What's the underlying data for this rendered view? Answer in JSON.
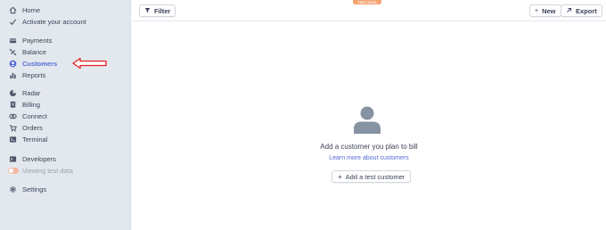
{
  "sidebar": {
    "group1": [
      {
        "label": "Home",
        "icon": "home-icon"
      },
      {
        "label": "Activate your account",
        "icon": "check-icon"
      }
    ],
    "group2": [
      {
        "label": "Payments",
        "icon": "payments-icon"
      },
      {
        "label": "Balance",
        "icon": "balance-icon"
      },
      {
        "label": "Customers",
        "icon": "customers-icon",
        "active": true
      },
      {
        "label": "Reports",
        "icon": "reports-icon"
      }
    ],
    "group3": [
      {
        "label": "Radar",
        "icon": "radar-icon"
      },
      {
        "label": "Billing",
        "icon": "billing-icon"
      },
      {
        "label": "Connect",
        "icon": "connect-icon"
      },
      {
        "label": "Orders",
        "icon": "orders-icon"
      },
      {
        "label": "Terminal",
        "icon": "terminal-icon"
      }
    ],
    "group4": [
      {
        "label": "Developers",
        "icon": "developers-icon"
      },
      {
        "label": "Viewing test data",
        "icon": "toggle-icon"
      }
    ],
    "group5": [
      {
        "label": "Settings",
        "icon": "gear-icon"
      }
    ]
  },
  "topbar": {
    "test_badge": "TEST DATA",
    "filter_label": "Filter",
    "new_label": "New",
    "export_label": "Export"
  },
  "empty_state": {
    "title": "Add a customer you plan to bill",
    "link": "Learn more about customers",
    "button": "Add a test customer"
  },
  "colors": {
    "accent": "#556cd6",
    "sidebar_bg": "#e3e8ee",
    "annotation_arrow": "#e02020",
    "test_badge": "#f5a16f"
  }
}
